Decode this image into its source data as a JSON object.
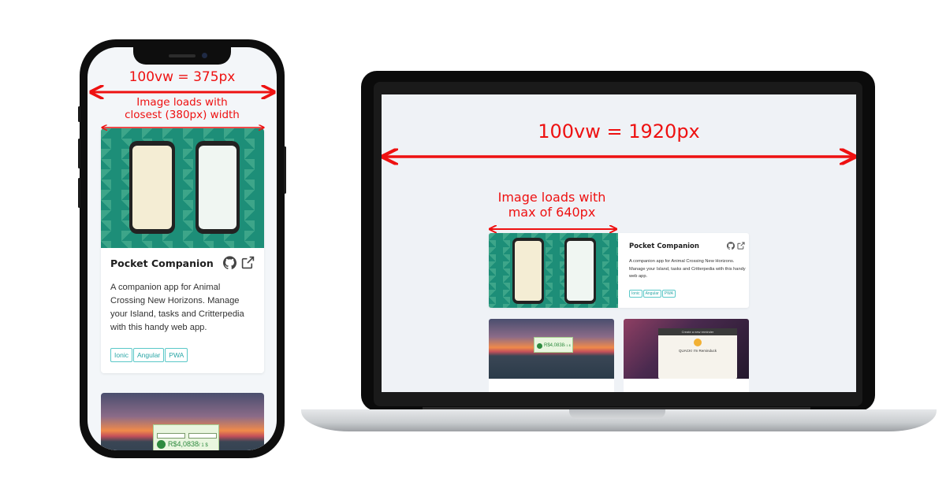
{
  "phone": {
    "vw_label": "100vw = 375px",
    "image_label": "Image loads with\nclosest (380px) width",
    "card": {
      "title": "Pocket Companion",
      "description": "A companion app for Animal Crossing New Horizons. Manage your Island, tasks and Critterpedia with this handy web app.",
      "tags": [
        "Ionic",
        "Angular",
        "PWA"
      ]
    },
    "second_card_price": "R$4,0838",
    "second_card_unit": "/ 1 $"
  },
  "laptop": {
    "vw_label": "100vw = 1920px",
    "image_label": "Image loads with\nmax of 640px",
    "card": {
      "title": "Pocket Companion",
      "description": "A companion app for Animal Crossing New Horizons. Manage your Island, tasks and Critterpedia with this handy web app.",
      "tags": [
        "Ionic",
        "Angular",
        "PWA"
      ]
    },
    "card2_price": "R$4,0838",
    "card2_unit": "/ 1 $",
    "card3_dialog_title": "Create a new reminder",
    "card3_heading": "QUACK! I'm Reminduck"
  },
  "colors": {
    "annotation_red": "#ee1111",
    "tag_teal": "#2aa6a6",
    "page_bg": "#eff2f6"
  },
  "icons": [
    "github-icon",
    "external-link-icon"
  ]
}
